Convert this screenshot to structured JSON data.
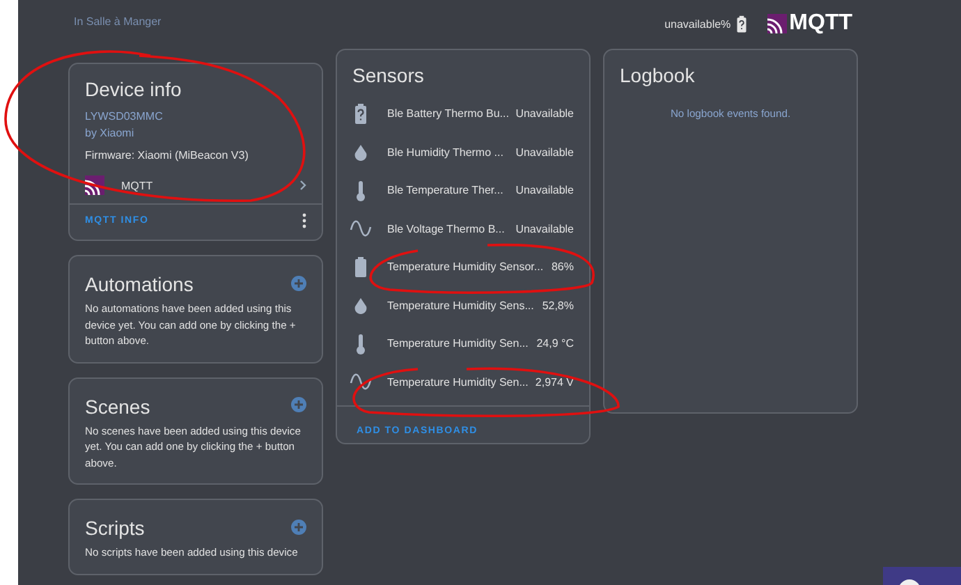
{
  "header": {
    "area": "In Salle à Manger",
    "battery_reading": "unavailable%",
    "logo": "MQTT"
  },
  "device_info": {
    "title": "Device info",
    "model": "LYWSD03MMC",
    "manufacturer": "by Xiaomi",
    "firmware": "Firmware: Xiaomi (MiBeacon V3)",
    "integration": "MQTT",
    "action": "MQTT INFO"
  },
  "related_cards": [
    {
      "title": "Automations",
      "message": "No automations have been added using this device yet. You can add one by clicking the + button above."
    },
    {
      "title": "Scenes",
      "message": "No scenes have been added using this device yet. You can add one by clicking the + button above."
    },
    {
      "title": "Scripts",
      "message": "No scripts have been added using this device"
    }
  ],
  "sensors": {
    "title": "Sensors",
    "entities": [
      {
        "kind": "battery_unknown",
        "name": "Ble Battery Thermo Bu...",
        "value": "Unavailable"
      },
      {
        "kind": "humidity",
        "name": "Ble Humidity Thermo ...",
        "value": "Unavailable"
      },
      {
        "kind": "temperature",
        "name": "Ble Temperature Ther...",
        "value": "Unavailable"
      },
      {
        "kind": "voltage",
        "name": "Ble Voltage Thermo B...",
        "value": "Unavailable"
      },
      {
        "kind": "battery",
        "name": "Temperature Humidity Sensor...",
        "value": "86%"
      },
      {
        "kind": "humidity",
        "name": "Temperature Humidity Sens...",
        "value": "52,8%"
      },
      {
        "kind": "temperature",
        "name": "Temperature Humidity Sen...",
        "value": "24,9 °C"
      },
      {
        "kind": "voltage",
        "name": "Temperature Humidity Sen...",
        "value": "2,974 V"
      }
    ],
    "action": "ADD TO DASHBOARD"
  },
  "logbook": {
    "title": "Logbook",
    "message": "No logbook events found."
  }
}
